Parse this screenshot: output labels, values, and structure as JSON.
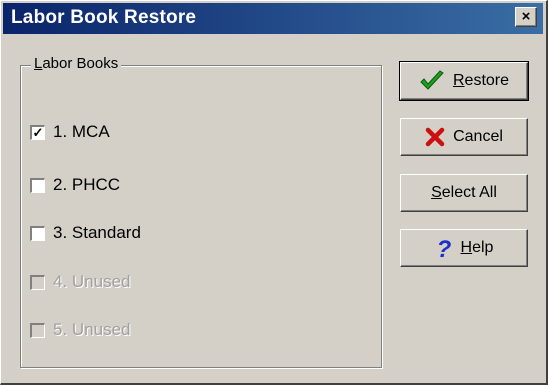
{
  "window": {
    "title": "Labor Book Restore",
    "close_glyph": "×"
  },
  "group": {
    "label": "Labor Books",
    "label_mnemonic": "L",
    "label_rest": "abor Books"
  },
  "books": [
    {
      "label": "1. MCA",
      "checked": true,
      "enabled": true
    },
    {
      "label": "2. PHCC",
      "checked": false,
      "enabled": true
    },
    {
      "label": "3. Standard",
      "checked": false,
      "enabled": true
    },
    {
      "label": "4. Unused",
      "checked": false,
      "enabled": false
    },
    {
      "label": "5. Unused",
      "checked": false,
      "enabled": false
    }
  ],
  "buttons": {
    "restore": {
      "label": "Restore",
      "mnemonic": "R",
      "rest": "estore",
      "icon": "checkmark-icon"
    },
    "cancel": {
      "label": "Cancel",
      "icon": "x-icon"
    },
    "select_all": {
      "label": "Select All",
      "mnemonic": "S",
      "rest": "elect All"
    },
    "help": {
      "label": "Help",
      "mnemonic": "H",
      "rest": "elp",
      "icon": "question-mark-icon"
    }
  },
  "colors": {
    "check_green": "#1e9e1e",
    "cancel_red": "#cc1010",
    "help_blue": "#1a32c8"
  }
}
